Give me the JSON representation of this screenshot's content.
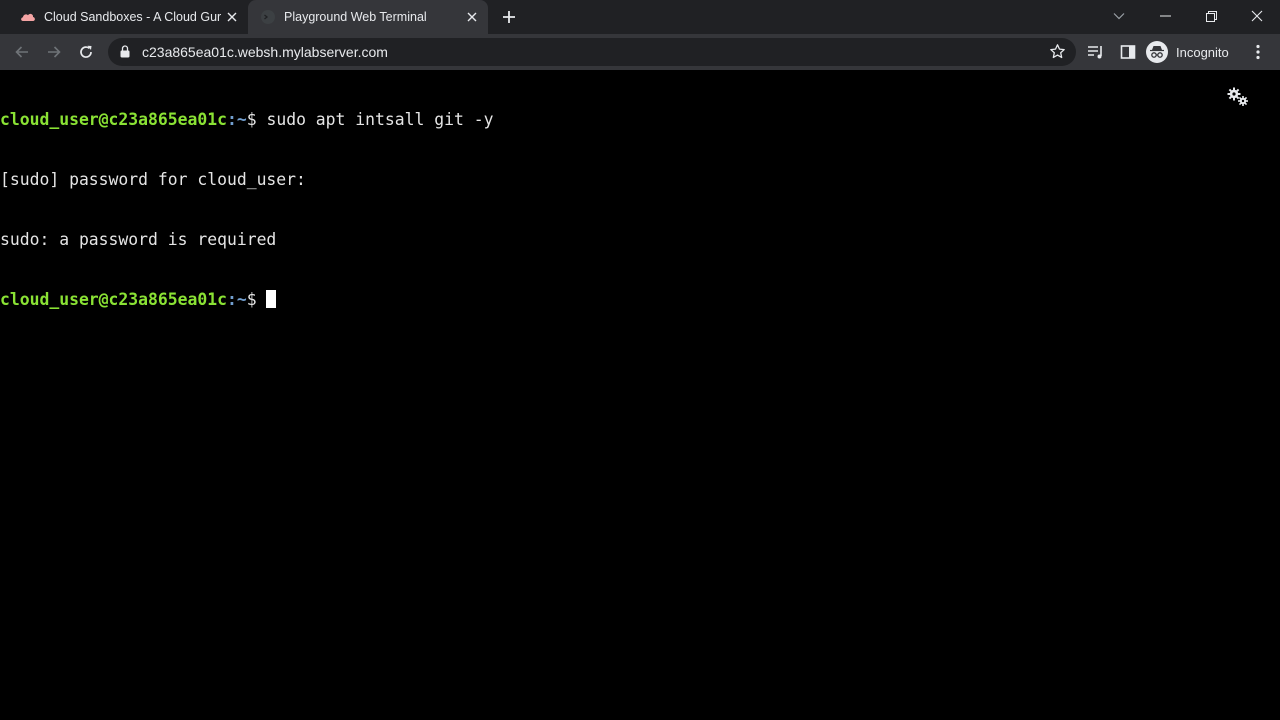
{
  "tabs": [
    {
      "title": "Cloud Sandboxes - A Cloud Guru",
      "favicon": "cloud-icon"
    },
    {
      "title": "Playground Web Terminal",
      "favicon": "terminal-icon",
      "active": true
    }
  ],
  "address_bar": {
    "url": "c23a865ea01c.websh.mylabserver.com"
  },
  "profile": {
    "label": "Incognito"
  },
  "terminal": {
    "lines": [
      {
        "user": "cloud_user@c23a865ea01c",
        "path": ":~",
        "symbol": "$ ",
        "command": "sudo apt intsall git -y"
      },
      {
        "output": "[sudo] password for cloud_user:"
      },
      {
        "output": "sudo: a password is required"
      },
      {
        "user": "cloud_user@c23a865ea01c",
        "path": ":~",
        "symbol": "$ ",
        "command": ""
      }
    ]
  },
  "colors": {
    "prompt_user": "#8ae234",
    "prompt_path": "#729fcf",
    "terminal_bg": "#000000"
  }
}
